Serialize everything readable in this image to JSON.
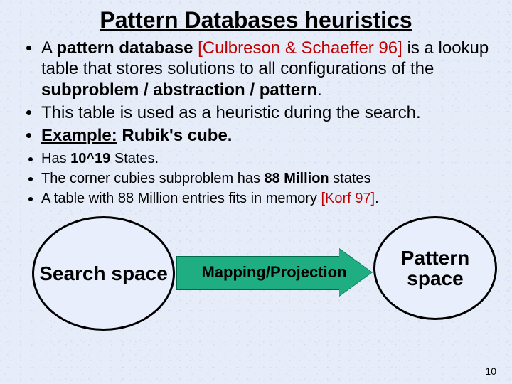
{
  "title": "Pattern Databases heuristics",
  "bullets_big": {
    "b1": {
      "pre": "A ",
      "bold1": "pattern database",
      "mid1": " ",
      "ref": "[Culbreson & Schaeffer 96]",
      "mid2": " is a lookup table that stores solutions to all configurations of the ",
      "bold2": "subproblem / abstraction / pattern",
      "post": "."
    },
    "b2": "This table is used as a heuristic during the search.",
    "b3": {
      "label": "Example:",
      "rest": "  Rubik's cube."
    }
  },
  "bullets_small": {
    "s1": {
      "pre": "Has ",
      "bold": "10^19",
      "post": " States."
    },
    "s2": {
      "pre": "The corner cubies subproblem has ",
      "bold": "88 Million",
      "post": " states"
    },
    "s3": {
      "pre": "A table with  88 Million entries fits in memory ",
      "ref": "[Korf 97]",
      "post": "."
    }
  },
  "diagram": {
    "left": "Search space",
    "arrow": "Mapping/Projection",
    "right": "Pattern space"
  },
  "page_number": "10"
}
